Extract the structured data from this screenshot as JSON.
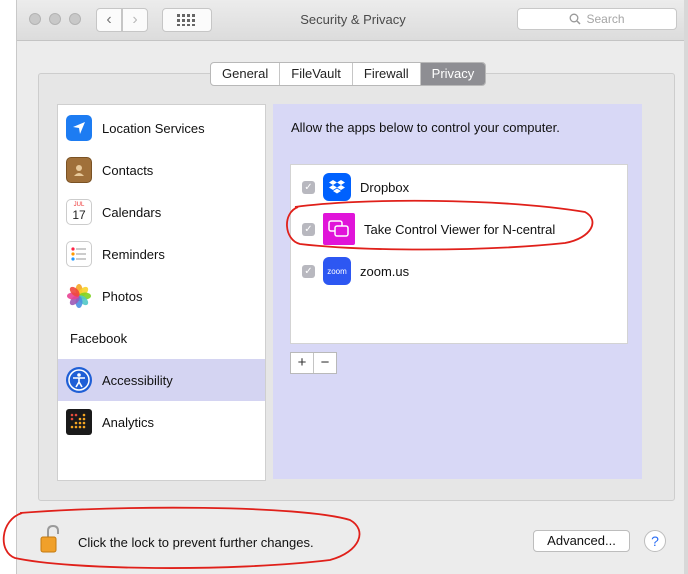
{
  "window": {
    "title": "Security & Privacy"
  },
  "toolbar": {
    "back_icon": "chevron-left-icon",
    "forward_icon": "chevron-right-icon",
    "grid_icon": "grid-icon",
    "search_placeholder": "Search"
  },
  "tabs": [
    {
      "label": "General",
      "active": false
    },
    {
      "label": "FileVault",
      "active": false
    },
    {
      "label": "Firewall",
      "active": false
    },
    {
      "label": "Privacy",
      "active": true
    }
  ],
  "sidebar": {
    "items": [
      {
        "label": "Location Services",
        "icon": "location-arrow-icon",
        "selected": false
      },
      {
        "label": "Contacts",
        "icon": "contacts-book-icon",
        "selected": false
      },
      {
        "label": "Calendars",
        "icon": "calendar-icon",
        "selected": false
      },
      {
        "label": "Reminders",
        "icon": "reminders-list-icon",
        "selected": false
      },
      {
        "label": "Photos",
        "icon": "photos-flower-icon",
        "selected": false
      },
      {
        "label": "Facebook",
        "icon": "",
        "selected": false
      },
      {
        "label": "Accessibility",
        "icon": "accessibility-person-icon",
        "selected": true
      },
      {
        "label": "Analytics",
        "icon": "analytics-dots-icon",
        "selected": false
      }
    ],
    "calendar_month": "JUL",
    "calendar_day": "17"
  },
  "main": {
    "allow_text": "Allow the apps below to control your computer.",
    "apps": [
      {
        "label": "Dropbox",
        "checked": true,
        "icon": "dropbox-icon",
        "color": "#0061fe"
      },
      {
        "label": "Take Control Viewer for N-central",
        "checked": true,
        "icon": "take-control-icon",
        "color": "#e014d9"
      },
      {
        "label": "zoom.us",
        "checked": true,
        "icon": "zoom-icon",
        "color": "#2d57f2",
        "icon_text": "zoom"
      }
    ],
    "add_label": "+",
    "remove_label": "−"
  },
  "footer": {
    "lock_text": "Click the lock to prevent further changes.",
    "advanced_label": "Advanced...",
    "help_label": "?"
  },
  "colors": {
    "selection": "#d4d4f2",
    "annotation": "#e0201a",
    "tab_active": "#8e8e93"
  }
}
